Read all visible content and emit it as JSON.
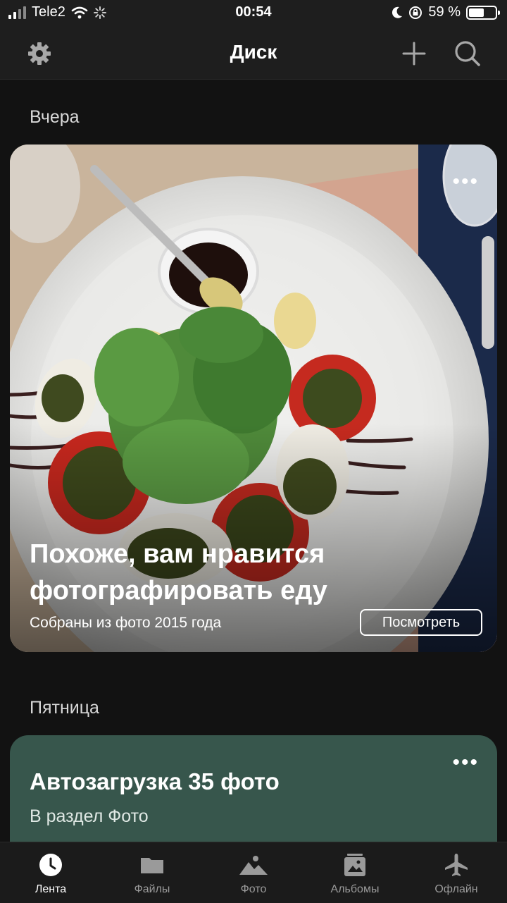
{
  "status_bar": {
    "carrier": "Tele2",
    "time": "00:54",
    "battery": "59 %",
    "battery_level": 0.59
  },
  "header": {
    "title": "Диск"
  },
  "feed": {
    "section1_label": "Вчера",
    "photo_card": {
      "title": "Похоже, вам нравится фотографировать еду",
      "subtitle": "Собраны из фото 2015 года",
      "button": "Посмотреть",
      "menu": "•••"
    },
    "section2_label": "Пятница",
    "upload_card": {
      "title": "Автозагрузка 35 фото",
      "subtitle": "В раздел Фото",
      "menu": "•••"
    }
  },
  "tabs": [
    {
      "label": "Лента",
      "icon": "clock-icon",
      "active": true
    },
    {
      "label": "Файлы",
      "icon": "folder-icon",
      "active": false
    },
    {
      "label": "Фото",
      "icon": "photo-icon",
      "active": false
    },
    {
      "label": "Альбомы",
      "icon": "album-icon",
      "active": false
    },
    {
      "label": "Офлайн",
      "icon": "airplane-icon",
      "active": false
    }
  ],
  "colors": {
    "background": "#121212",
    "bar": "#1e1e1e",
    "upload_card": "#37564c"
  }
}
